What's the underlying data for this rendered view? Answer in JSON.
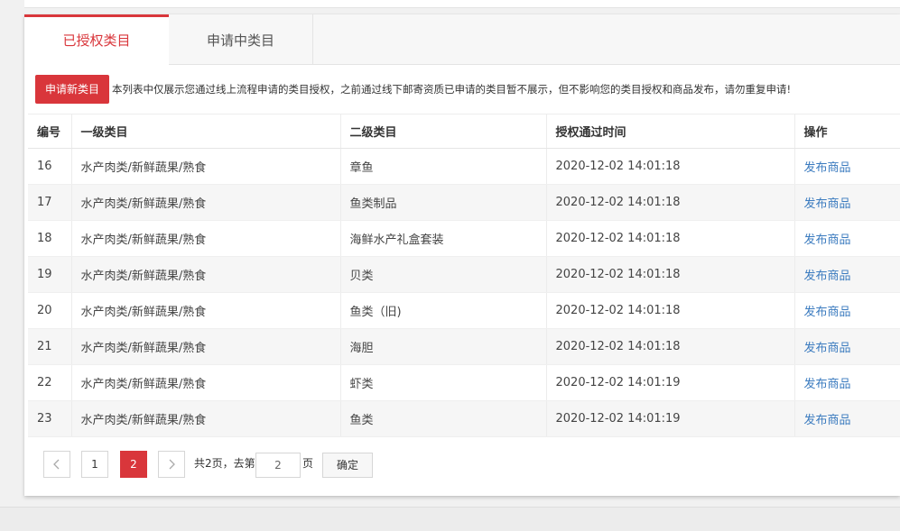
{
  "tabs": [
    {
      "label": "已授权类目",
      "active": true
    },
    {
      "label": "申请中类目",
      "active": false
    }
  ],
  "notice": {
    "button_label": "申请新类目",
    "text": "本列表中仅展示您通过线上流程申请的类目授权，之前通过线下邮寄资质已申请的类目暂不展示，但不影响您的类目授权和商品发布，请勿重复申请!"
  },
  "table": {
    "headers": [
      "编号",
      "一级类目",
      "二级类目",
      "授权通过时间",
      "操作"
    ],
    "rows": [
      {
        "id": "16",
        "level1": "水产肉类/新鲜蔬果/熟食",
        "level2": "章鱼",
        "time": "2020-12-02 14:01:18",
        "action": "发布商品"
      },
      {
        "id": "17",
        "level1": "水产肉类/新鲜蔬果/熟食",
        "level2": "鱼类制品",
        "time": "2020-12-02 14:01:18",
        "action": "发布商品"
      },
      {
        "id": "18",
        "level1": "水产肉类/新鲜蔬果/熟食",
        "level2": "海鲜水产礼盒套装",
        "time": "2020-12-02 14:01:18",
        "action": "发布商品"
      },
      {
        "id": "19",
        "level1": "水产肉类/新鲜蔬果/熟食",
        "level2": "贝类",
        "time": "2020-12-02 14:01:18",
        "action": "发布商品"
      },
      {
        "id": "20",
        "level1": "水产肉类/新鲜蔬果/熟食",
        "level2": "鱼类（旧)",
        "time": "2020-12-02 14:01:18",
        "action": "发布商品"
      },
      {
        "id": "21",
        "level1": "水产肉类/新鲜蔬果/熟食",
        "level2": "海胆",
        "time": "2020-12-02 14:01:18",
        "action": "发布商品"
      },
      {
        "id": "22",
        "level1": "水产肉类/新鲜蔬果/熟食",
        "level2": "虾类",
        "time": "2020-12-02 14:01:19",
        "action": "发布商品"
      },
      {
        "id": "23",
        "level1": "水产肉类/新鲜蔬果/熟食",
        "level2": "鱼类",
        "time": "2020-12-02 14:01:19",
        "action": "发布商品"
      }
    ]
  },
  "pagination": {
    "prev_icon": "chevron-left-icon",
    "next_icon": "chevron-right-icon",
    "pages": [
      "1",
      "2"
    ],
    "current_page": "2",
    "total_text": "共2页，去第",
    "goto_value": "2",
    "page_suffix": "页",
    "confirm_label": "确定"
  },
  "colors": {
    "accent": "#d9363b",
    "link": "#3b7bbf"
  }
}
